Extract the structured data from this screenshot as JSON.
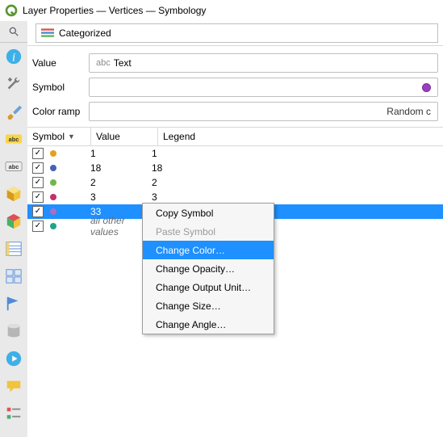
{
  "title": "Layer Properties — Vertices — Symbology",
  "sidebar_icons": [
    "search",
    "info",
    "tools",
    "brush",
    "abc-y",
    "abc",
    "cube-y",
    "cube-c",
    "list",
    "grid",
    "flag",
    "db",
    "play",
    "balloon",
    "legend"
  ],
  "panel": {
    "renderer": "Categorized",
    "labels": {
      "value": "Value",
      "symbol": "Symbol",
      "colorramp": "Color ramp"
    },
    "value_field": "Text",
    "value_prefix": "abc",
    "symbol_color": "#9a3fbf",
    "color_ramp": "Random c"
  },
  "table": {
    "headers": {
      "symbol": "Symbol",
      "value": "Value",
      "legend": "Legend"
    },
    "rows": [
      {
        "checked": true,
        "color": "#e3a21e",
        "value": "1",
        "legend": "1",
        "sel": false
      },
      {
        "checked": true,
        "color": "#4a5fb8",
        "value": "18",
        "legend": "18",
        "sel": false
      },
      {
        "checked": true,
        "color": "#6fb84a",
        "value": "2",
        "legend": "2",
        "sel": false
      },
      {
        "checked": true,
        "color": "#c42f6d",
        "value": "3",
        "legend": "3",
        "sel": false
      },
      {
        "checked": true,
        "color": "#a76fc7",
        "value": "33",
        "legend": "33",
        "sel": true
      },
      {
        "checked": true,
        "color": "#1fa588",
        "value": "all other values",
        "legend": "",
        "sel": false,
        "italic": true
      }
    ]
  },
  "context_menu": {
    "items": [
      {
        "label": "Copy Symbol",
        "state": "normal"
      },
      {
        "label": "Paste Symbol",
        "state": "disabled"
      },
      {
        "label": "Change Color…",
        "state": "highlight"
      },
      {
        "label": "Change Opacity…",
        "state": "normal"
      },
      {
        "label": "Change Output Unit…",
        "state": "normal"
      },
      {
        "label": "Change Size…",
        "state": "normal"
      },
      {
        "label": "Change Angle…",
        "state": "normal"
      }
    ]
  }
}
